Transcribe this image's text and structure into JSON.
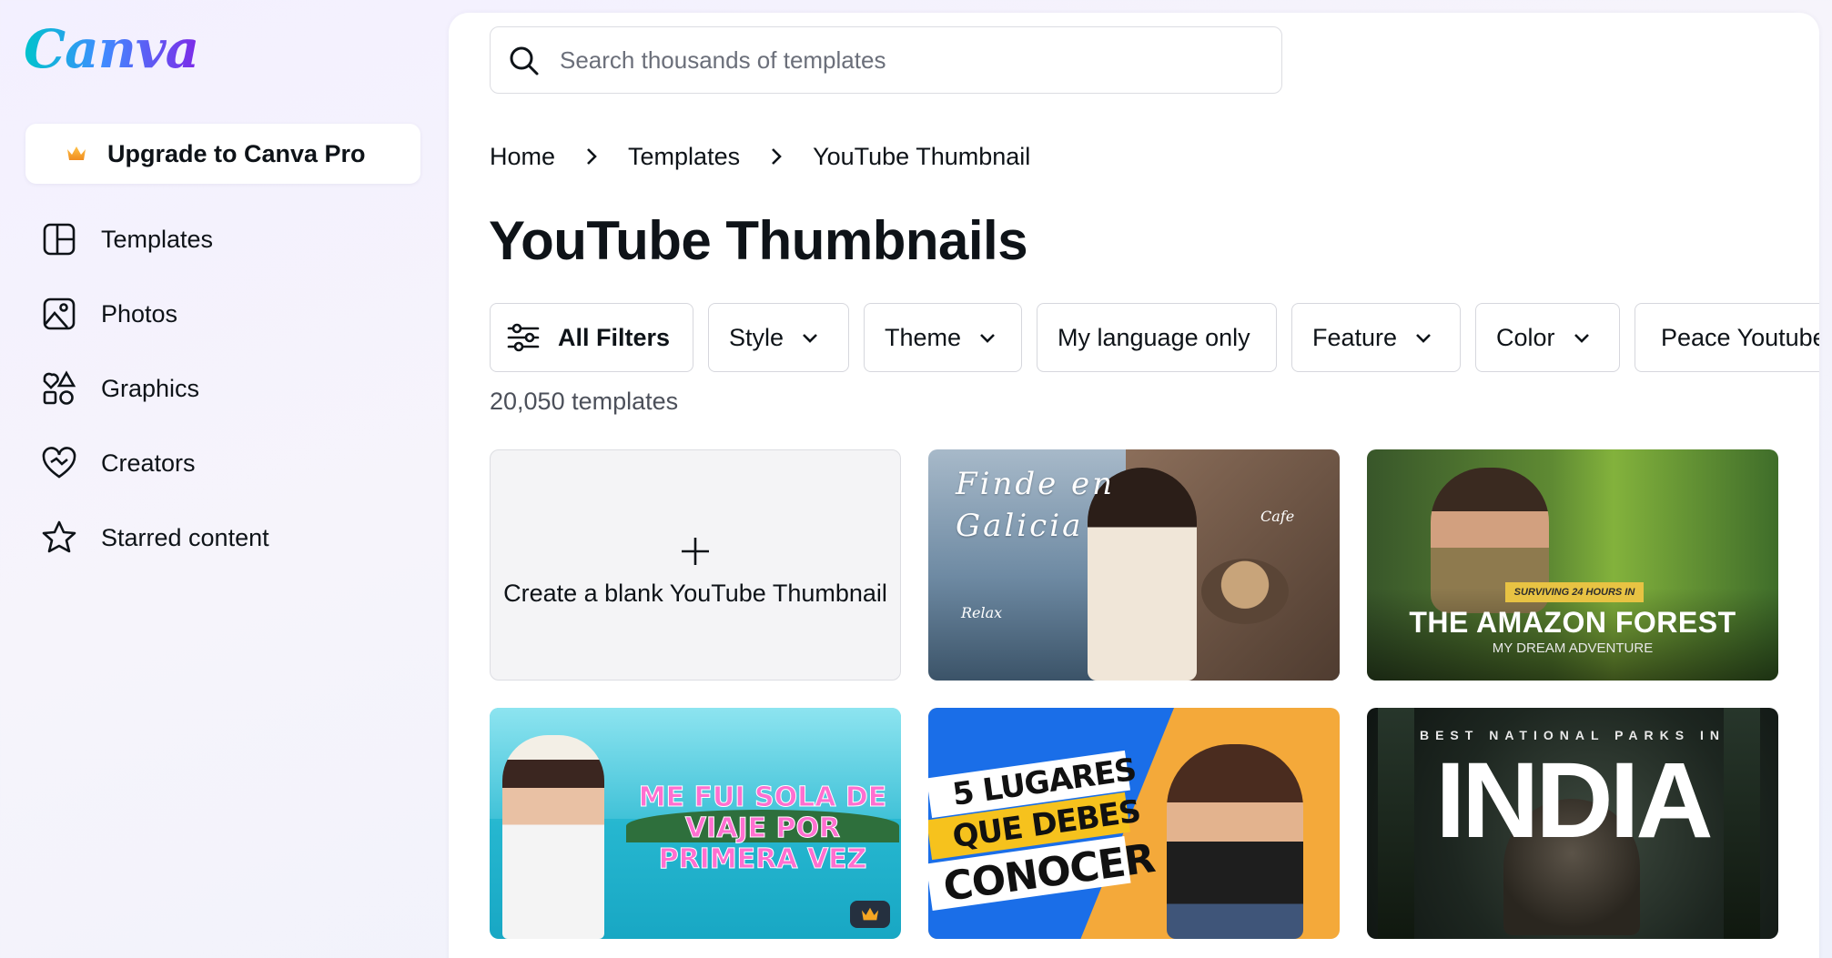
{
  "app": {
    "name": "Canva"
  },
  "sidebar": {
    "upgrade_label": "Upgrade to Canva Pro",
    "items": [
      {
        "label": "Templates",
        "icon": "templates-icon"
      },
      {
        "label": "Photos",
        "icon": "photos-icon"
      },
      {
        "label": "Graphics",
        "icon": "graphics-icon"
      },
      {
        "label": "Creators",
        "icon": "creators-icon"
      },
      {
        "label": "Starred content",
        "icon": "star-icon"
      }
    ]
  },
  "search": {
    "placeholder": "Search thousands of templates",
    "value": ""
  },
  "breadcrumb": [
    "Home",
    "Templates",
    "YouTube Thumbnail"
  ],
  "page_title": "YouTube Thumbnails",
  "filters": {
    "all": "All Filters",
    "style": "Style",
    "theme": "Theme",
    "language": "My language only",
    "feature": "Feature",
    "color": "Color",
    "peace": "Peace Youtube"
  },
  "template_count": "20,050 templates",
  "blank_card_label": "Create a blank YouTube Thumbnail",
  "thumbnails": {
    "galicia": {
      "line1": "Finde en",
      "line2": "Galicia",
      "cafe": "Cafe",
      "relax": "Relax"
    },
    "amazon": {
      "tag": "SURVIVING 24 HOURS IN",
      "title": "THE AMAZON FOREST",
      "subtitle": "MY DREAM ADVENTURE"
    },
    "sola": {
      "line1": "ME FUI SOLA DE",
      "line2": "VIAJE POR",
      "line3": "PRIMERA VEZ"
    },
    "lugares": {
      "line1": "5 LUGARES",
      "line2": "QUE DEBES",
      "line3": "CONOCER"
    },
    "india": {
      "top": "BEST NATIONAL PARKS IN",
      "title": "INDIA"
    }
  },
  "colors": {
    "brand_start": "#00c4cc",
    "brand_end": "#7d2ae8",
    "crown": "#f5a623"
  }
}
